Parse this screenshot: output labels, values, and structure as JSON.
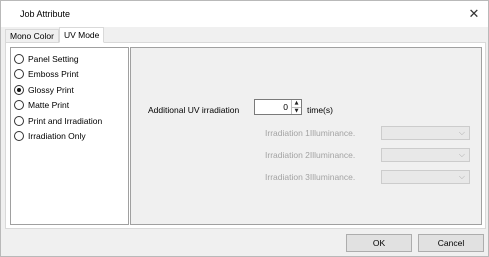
{
  "window": {
    "title": "Job Attribute",
    "close_glyph": "✕"
  },
  "tabs": [
    {
      "label": "Mono Color",
      "active": false
    },
    {
      "label": "UV Mode",
      "active": true
    }
  ],
  "modes": [
    {
      "label": "Panel Setting",
      "checked": false
    },
    {
      "label": "Emboss Print",
      "checked": false
    },
    {
      "label": "Glossy Print",
      "checked": true
    },
    {
      "label": "Matte Print",
      "checked": false
    },
    {
      "label": "Print and Irradiation",
      "checked": false
    },
    {
      "label": "Irradiation Only",
      "checked": false
    }
  ],
  "uv": {
    "label": "Additional UV irradiation",
    "value": "0",
    "unit": "time(s)"
  },
  "irradiation": [
    {
      "label": "Irradiation 1Illuminance.",
      "value": ""
    },
    {
      "label": "Irradiation 2Illuminance.",
      "value": ""
    },
    {
      "label": "Irradiation 3Illuminance.",
      "value": ""
    }
  ],
  "buttons": {
    "ok": "OK",
    "cancel": "Cancel"
  },
  "icons": {
    "up": "▲",
    "down": "▼",
    "dropdown": "⌵"
  },
  "colors": {
    "window_bg": "#f0f0f0",
    "disabled_text": "#a3a3a3"
  }
}
